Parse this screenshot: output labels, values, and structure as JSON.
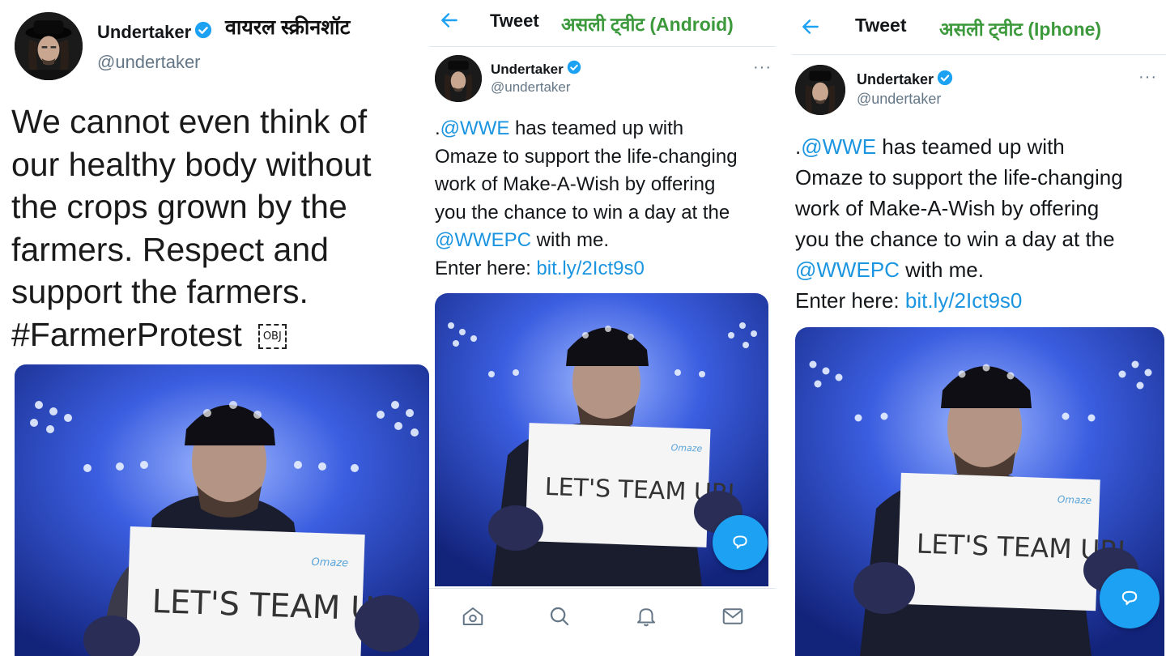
{
  "panel_viral": {
    "label": "वायरल स्क्रीनशॉट",
    "author_name": "Undertaker",
    "author_handle": "@undertaker",
    "tweet_lines": [
      "We cannot even think of",
      "our healthy body without",
      "the crops grown by the",
      "farmers. Respect and",
      "support the farmers.",
      "#FarmerProtest"
    ],
    "obj_marker": "OBJ",
    "sign_brand": "Omaze",
    "sign_text": "LET'S TEAM UP!"
  },
  "panel_android": {
    "label": "असली ट्वीट (Android)",
    "header_title": "Tweet",
    "author_name": "Undertaker",
    "author_handle": "@undertaker",
    "more": "···",
    "line1_prefix": ".",
    "line1_mention": "@WWE",
    "line1_rest": " has teamed up with",
    "line2": "Omaze to support the life-changing",
    "line3": "work of Make-A-Wish by offering",
    "line4": "you the chance to win a day at the",
    "line5_mention": "@WWEPC",
    "line5_rest": " with me.",
    "line6_prefix": "Enter here: ",
    "line6_link": "bit.ly/2Ict9s0",
    "sign_brand": "Omaze",
    "sign_text": "LET'S TEAM UP!",
    "nav_items": [
      "home-icon",
      "search-icon",
      "notifications-icon",
      "messages-icon"
    ]
  },
  "panel_iphone": {
    "label": "असली ट्वीट (Iphone)",
    "header_title": "Tweet",
    "author_name": "Undertaker",
    "author_handle": "@undertaker",
    "more": "···",
    "line1_prefix": ".",
    "line1_mention": "@WWE",
    "line1_rest": " has teamed up with",
    "line2": "Omaze to support the life-changing",
    "line3": "work of Make-A-Wish by offering",
    "line4": "you the chance to win a day at the",
    "line5_mention": "@WWEPC",
    "line5_rest": " with me.",
    "line6_prefix": "Enter here: ",
    "line6_link": "bit.ly/2Ict9s0",
    "sign_brand": "Omaze",
    "sign_text": "LET'S TEAM UP!"
  },
  "colors": {
    "twitter_blue": "#1da1f2",
    "link_blue": "#1b95e0",
    "label_green": "#3c9a3c",
    "label_black": "#111111",
    "stadium_blue": "#2b49c9"
  }
}
